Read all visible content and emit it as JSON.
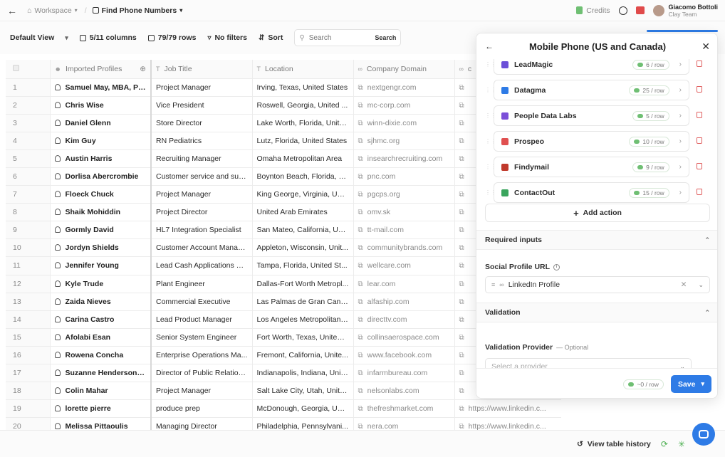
{
  "topbar": {
    "back_icon": "arrow-left-icon",
    "workspace": "Workspace",
    "table_name": "Find Phone Numbers",
    "credits": "Credits",
    "user_name": "Giacomo Bottoli",
    "user_team": "Clay Team"
  },
  "toolbar": {
    "view": "Default View",
    "columns": "5/11 columns",
    "rows": "79/79 rows",
    "filters": "No filters",
    "sort": "Sort",
    "search_placeholder": "Search",
    "search_button": "Search"
  },
  "table": {
    "headers": [
      "Imported Profiles",
      "Job Title",
      "Location",
      "Company Domain",
      "c"
    ],
    "rows": [
      {
        "n": "1",
        "name": "Samuel May, MBA, PMP",
        "title": "Project Manager",
        "loc": "Irving, Texas, United States",
        "dom": "nextgengr.com"
      },
      {
        "n": "2",
        "name": "Chris Wise",
        "title": "Vice President",
        "loc": "Roswell, Georgia, United ...",
        "dom": "mc-corp.com"
      },
      {
        "n": "3",
        "name": "Daniel Glenn",
        "title": "Store Director",
        "loc": "Lake Worth, Florida, Unite...",
        "dom": "winn-dixie.com"
      },
      {
        "n": "4",
        "name": "Kim Guy",
        "title": "RN Pediatrics",
        "loc": "Lutz, Florida, United States",
        "dom": "sjhmc.org"
      },
      {
        "n": "5",
        "name": "Austin Harris",
        "title": "Recruiting Manager",
        "loc": "Omaha Metropolitan Area",
        "dom": "insearchrecruiting.com"
      },
      {
        "n": "6",
        "name": "Dorlisa Abercrombie",
        "title": "Customer service and sup...",
        "loc": "Boynton Beach, Florida, U...",
        "dom": "pnc.com"
      },
      {
        "n": "7",
        "name": "Floeck Chuck",
        "title": "Project Manager",
        "loc": "King George, Virginia, Uni...",
        "dom": "pgcps.org"
      },
      {
        "n": "8",
        "name": "Shaik Mohiddin",
        "title": "Project Director",
        "loc": "United Arab Emirates",
        "dom": "omv.sk"
      },
      {
        "n": "9",
        "name": "Gormly David",
        "title": "HL7 Integration Specialist",
        "loc": "San Mateo, California, Uni...",
        "dom": "tt-mail.com"
      },
      {
        "n": "10",
        "name": "Jordyn Shields",
        "title": "Customer Account Manager",
        "loc": "Appleton, Wisconsin, Unit...",
        "dom": "communitybrands.com"
      },
      {
        "n": "11",
        "name": "Jennifer Young",
        "title": "Lead Cash Applications C...",
        "loc": "Tampa, Florida, United St...",
        "dom": "wellcare.com"
      },
      {
        "n": "12",
        "name": "Kyle Trude",
        "title": "Plant Engineer",
        "loc": "Dallas-Fort Worth Metropl...",
        "dom": "lear.com"
      },
      {
        "n": "13",
        "name": "Zaida Nieves",
        "title": "Commercial Executive",
        "loc": "Las Palmas de Gran Cana...",
        "dom": "alfaship.com"
      },
      {
        "n": "14",
        "name": "Carina Castro",
        "title": "Lead Product Manager",
        "loc": "Los Angeles Metropolitan ...",
        "dom": "directtv.com"
      },
      {
        "n": "15",
        "name": "Afolabi Esan",
        "title": "Senior System Engineer",
        "loc": "Fort Worth, Texas, United ...",
        "dom": "collinsaerospace.com"
      },
      {
        "n": "16",
        "name": "Rowena Concha",
        "title": "Enterprise Operations Ma...",
        "loc": "Fremont, California, Unite...",
        "dom": "www.facebook.com"
      },
      {
        "n": "17",
        "name": "Suzanne Henderson, ...",
        "title": "Director of Public Relation...",
        "loc": "Indianapolis, Indiana, Unit...",
        "dom": "infarmbureau.com"
      },
      {
        "n": "18",
        "name": "Colin Mahar",
        "title": "Project Manager",
        "loc": "Salt Lake City, Utah, Unite...",
        "dom": "nelsonlabs.com"
      },
      {
        "n": "19",
        "name": "lorette pierre",
        "title": "produce prep",
        "loc": "McDonough, Georgia, Unit...",
        "dom": "thefreshmarket.com",
        "extra": "https://www.linkedin.c..."
      },
      {
        "n": "20",
        "name": "Melissa Pittaoulis",
        "title": "Managing Director",
        "loc": "Philadelphia, Pennsylvani...",
        "dom": "nera.com",
        "extra": "https://www.linkedin.c..."
      }
    ]
  },
  "panel": {
    "title": "Mobile Phone (US and Canada)",
    "providers": [
      {
        "name": "LeadMagic",
        "cost": "6 / row",
        "color": "#6b4fd8"
      },
      {
        "name": "Datagma",
        "cost": "25 / row",
        "color": "#2e7be6"
      },
      {
        "name": "People Data Labs",
        "cost": "5 / row",
        "color": "#7b4fd8"
      },
      {
        "name": "Prospeo",
        "cost": "10 / row",
        "color": "#e05050"
      },
      {
        "name": "Findymail",
        "cost": "9 / row",
        "color": "#c0392b"
      },
      {
        "name": "ContactOut",
        "cost": "15 / row",
        "color": "#3aa55d"
      }
    ],
    "add_action": "Add action",
    "required_inputs": "Required inputs",
    "social_label": "Social Profile URL",
    "social_value": "LinkedIn Profile",
    "validation": "Validation",
    "validation_provider": "Validation Provider",
    "optional": "— Optional",
    "provider_placeholder": "Select a provider",
    "footer_cost": "~0 / row",
    "save": "Save"
  },
  "bottombar": {
    "history": "View table history"
  },
  "colors": {
    "accent": "#2e7be6",
    "credit_green": "#6fbf73",
    "trash_red": "#e06060"
  }
}
